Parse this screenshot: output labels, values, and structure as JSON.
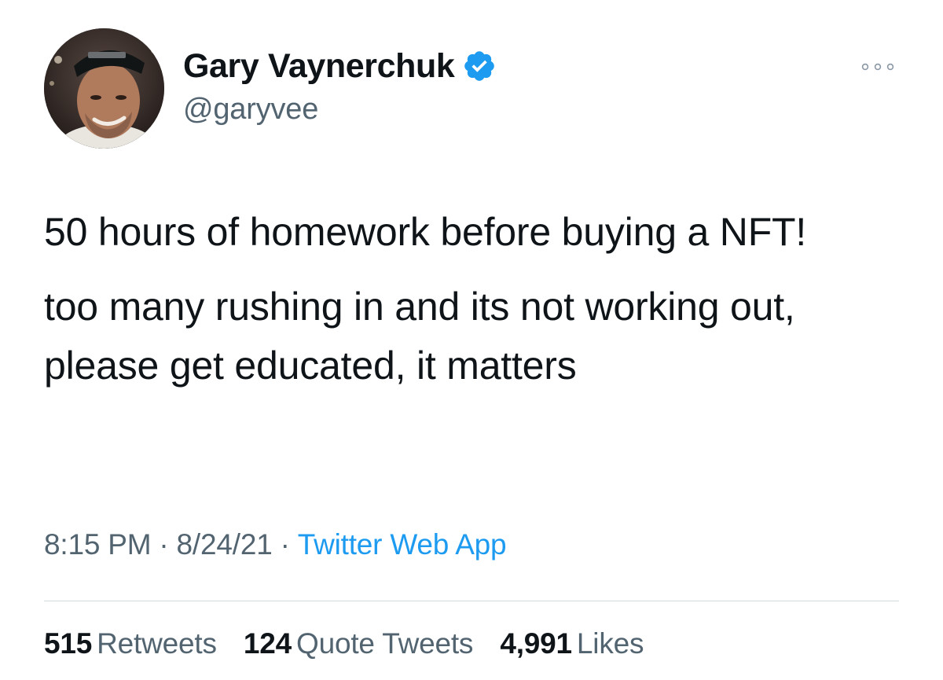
{
  "author": {
    "display_name": "Gary Vaynerchuk",
    "handle": "@garyvee",
    "verified": true,
    "avatar_icon": "profile-photo"
  },
  "tweet": {
    "paragraphs": [
      "50 hours of homework before buying a NFT!",
      "too many rushing in and its not working out, please get educated, it matters"
    ],
    "time": "8:15 PM",
    "date": "8/24/21",
    "source": "Twitter Web App",
    "separator": "·"
  },
  "stats": {
    "retweets": {
      "count": "515",
      "label": "Retweets"
    },
    "quote_tweets": {
      "count": "124",
      "label": "Quote Tweets"
    },
    "likes": {
      "count": "4,991",
      "label": "Likes"
    }
  },
  "icons": {
    "verified": "verified-badge-icon",
    "more": "more-options-icon"
  },
  "colors": {
    "text": "#0f1419",
    "secondary": "#536471",
    "accent": "#1d9bf0",
    "divider": "#cfd9de"
  }
}
